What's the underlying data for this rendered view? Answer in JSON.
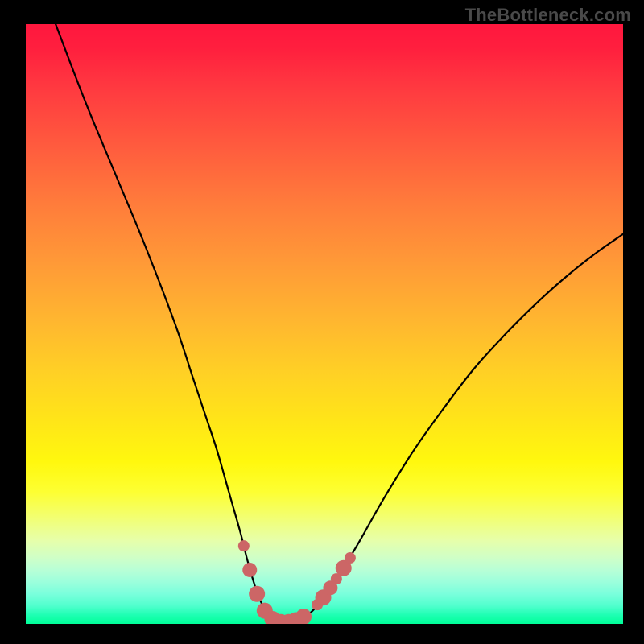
{
  "watermark": "TheBottleneck.com",
  "colors": {
    "top": "#ff173e",
    "mid": "#ffe21a",
    "bottom": "#00ff99",
    "curve": "#000000",
    "marker_fill": "#cc6666",
    "marker_stroke": "#a94e4e"
  },
  "chart_data": {
    "type": "line",
    "title": "",
    "xlabel": "",
    "ylabel": "",
    "xlim": [
      0,
      100
    ],
    "ylim": [
      0,
      100
    ],
    "grid": false,
    "series": [
      {
        "name": "bottleneck-curve",
        "x": [
          5,
          10,
          15,
          20,
          25,
          28,
          30,
          32,
          34,
          36,
          37,
          38,
          39,
          40,
          41,
          42,
          43,
          44,
          45,
          47,
          49,
          50,
          53,
          56,
          60,
          65,
          70,
          75,
          80,
          85,
          90,
          95,
          100
        ],
        "y": [
          100,
          87,
          75,
          63,
          50,
          41,
          35,
          29,
          22,
          15,
          11,
          7.5,
          4.5,
          2.5,
          1.2,
          0.5,
          0.2,
          0.2,
          0.4,
          1.3,
          3.2,
          4.5,
          9,
          14,
          21,
          29,
          36,
          42.5,
          48,
          53,
          57.5,
          61.5,
          65
        ]
      }
    ],
    "markers": [
      {
        "x": 36.5,
        "y": 13,
        "r": 7
      },
      {
        "x": 37.5,
        "y": 9,
        "r": 9
      },
      {
        "x": 38.7,
        "y": 5,
        "r": 10
      },
      {
        "x": 40.0,
        "y": 2.2,
        "r": 10
      },
      {
        "x": 41.3,
        "y": 0.8,
        "r": 10
      },
      {
        "x": 42.7,
        "y": 0.3,
        "r": 10
      },
      {
        "x": 44.0,
        "y": 0.3,
        "r": 10
      },
      {
        "x": 45.2,
        "y": 0.6,
        "r": 10
      },
      {
        "x": 46.5,
        "y": 1.2,
        "r": 10
      },
      {
        "x": 48.8,
        "y": 3.2,
        "r": 7
      },
      {
        "x": 49.8,
        "y": 4.4,
        "r": 10
      },
      {
        "x": 51.0,
        "y": 6.0,
        "r": 9
      },
      {
        "x": 52.0,
        "y": 7.5,
        "r": 7
      },
      {
        "x": 53.2,
        "y": 9.3,
        "r": 10
      },
      {
        "x": 54.3,
        "y": 11.0,
        "r": 7
      }
    ]
  }
}
